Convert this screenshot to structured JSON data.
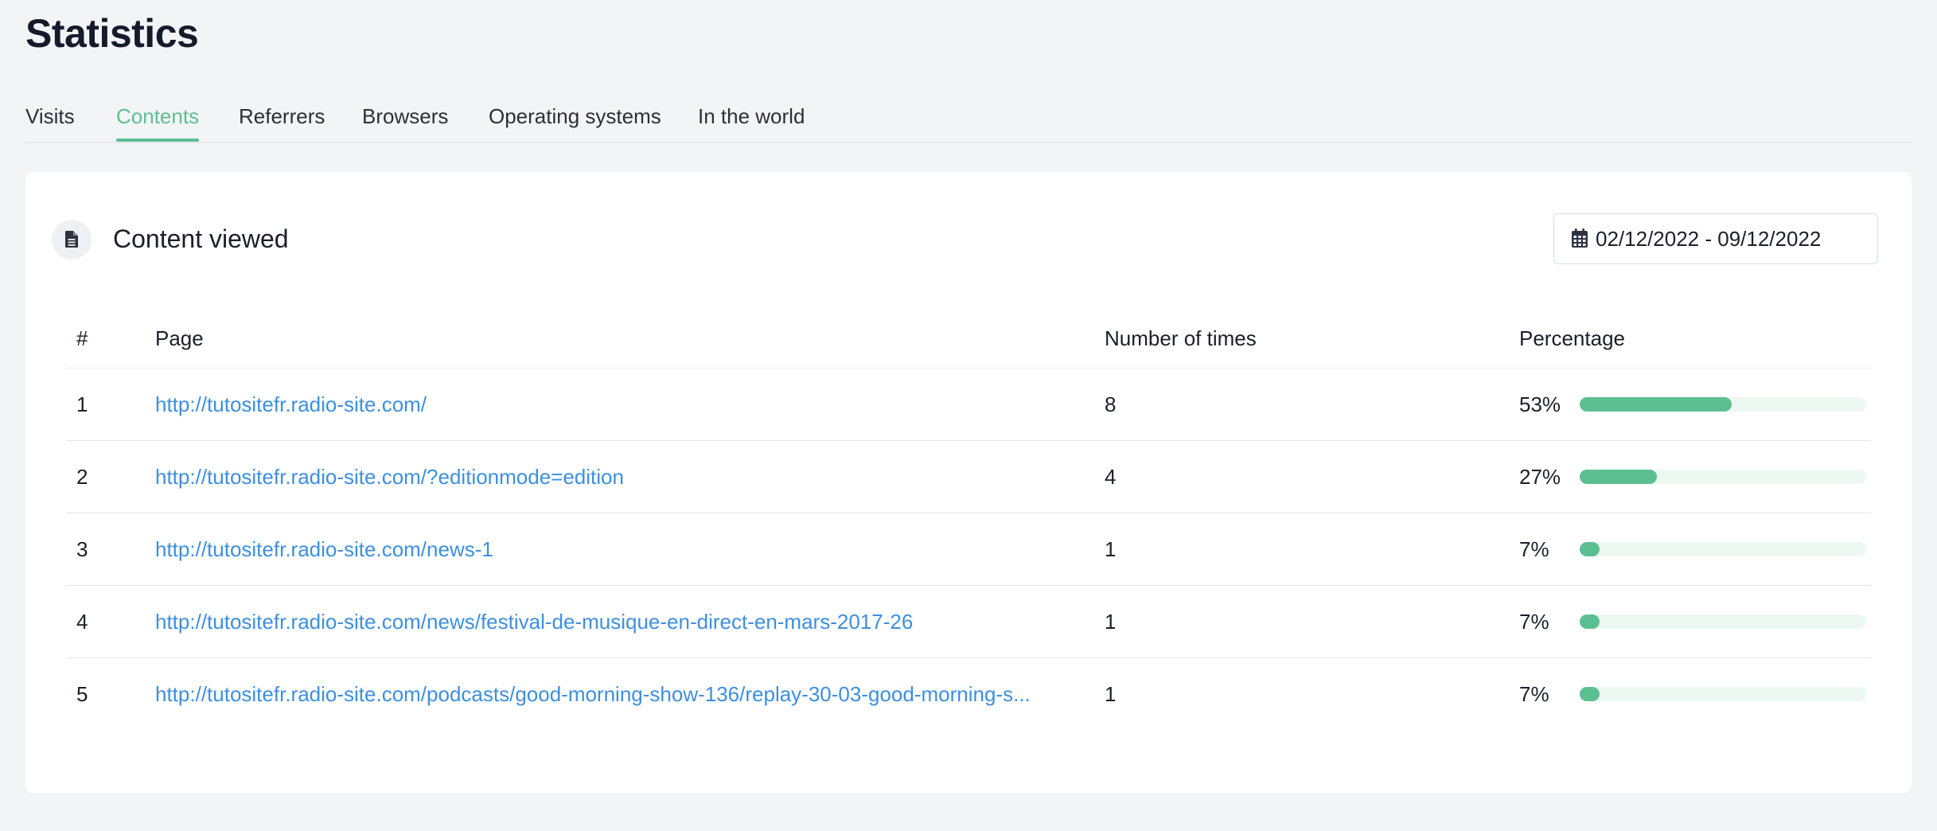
{
  "page": {
    "title": "Statistics"
  },
  "tabs": [
    {
      "label": "Visits",
      "active": false
    },
    {
      "label": "Contents",
      "active": true
    },
    {
      "label": "Referrers",
      "active": false
    },
    {
      "label": "Browsers",
      "active": false
    },
    {
      "label": "Operating systems",
      "active": false
    },
    {
      "label": "In the world",
      "active": false
    }
  ],
  "card": {
    "icon": "document-icon",
    "title": "Content viewed",
    "date_range": {
      "icon": "calendar-icon",
      "value": "02/12/2022 - 09/12/2022"
    }
  },
  "table": {
    "headers": {
      "rank": "#",
      "page": "Page",
      "count": "Number of times",
      "percentage": "Percentage"
    },
    "rows": [
      {
        "rank": "1",
        "page": "http://tutositefr.radio-site.com/",
        "count": "8",
        "percentage": "53%",
        "fraction": 0.53
      },
      {
        "rank": "2",
        "page": "http://tutositefr.radio-site.com/?editionmode=edition",
        "count": "4",
        "percentage": "27%",
        "fraction": 0.27
      },
      {
        "rank": "3",
        "page": "http://tutositefr.radio-site.com/news-1",
        "count": "1",
        "percentage": "7%",
        "fraction": 0.07
      },
      {
        "rank": "4",
        "page": "http://tutositefr.radio-site.com/news/festival-de-musique-en-direct-en-mars-2017-26",
        "count": "1",
        "percentage": "7%",
        "fraction": 0.07
      },
      {
        "rank": "5",
        "page": "http://tutositefr.radio-site.com/podcasts/good-morning-show-136/replay-30-03-good-morning-s...",
        "count": "1",
        "percentage": "7%",
        "fraction": 0.07
      }
    ]
  },
  "colors": {
    "accent": "#5cbf92",
    "link": "#3d8fe0",
    "bar_track": "#eef8f3",
    "page_background": "#f3f4f6"
  }
}
